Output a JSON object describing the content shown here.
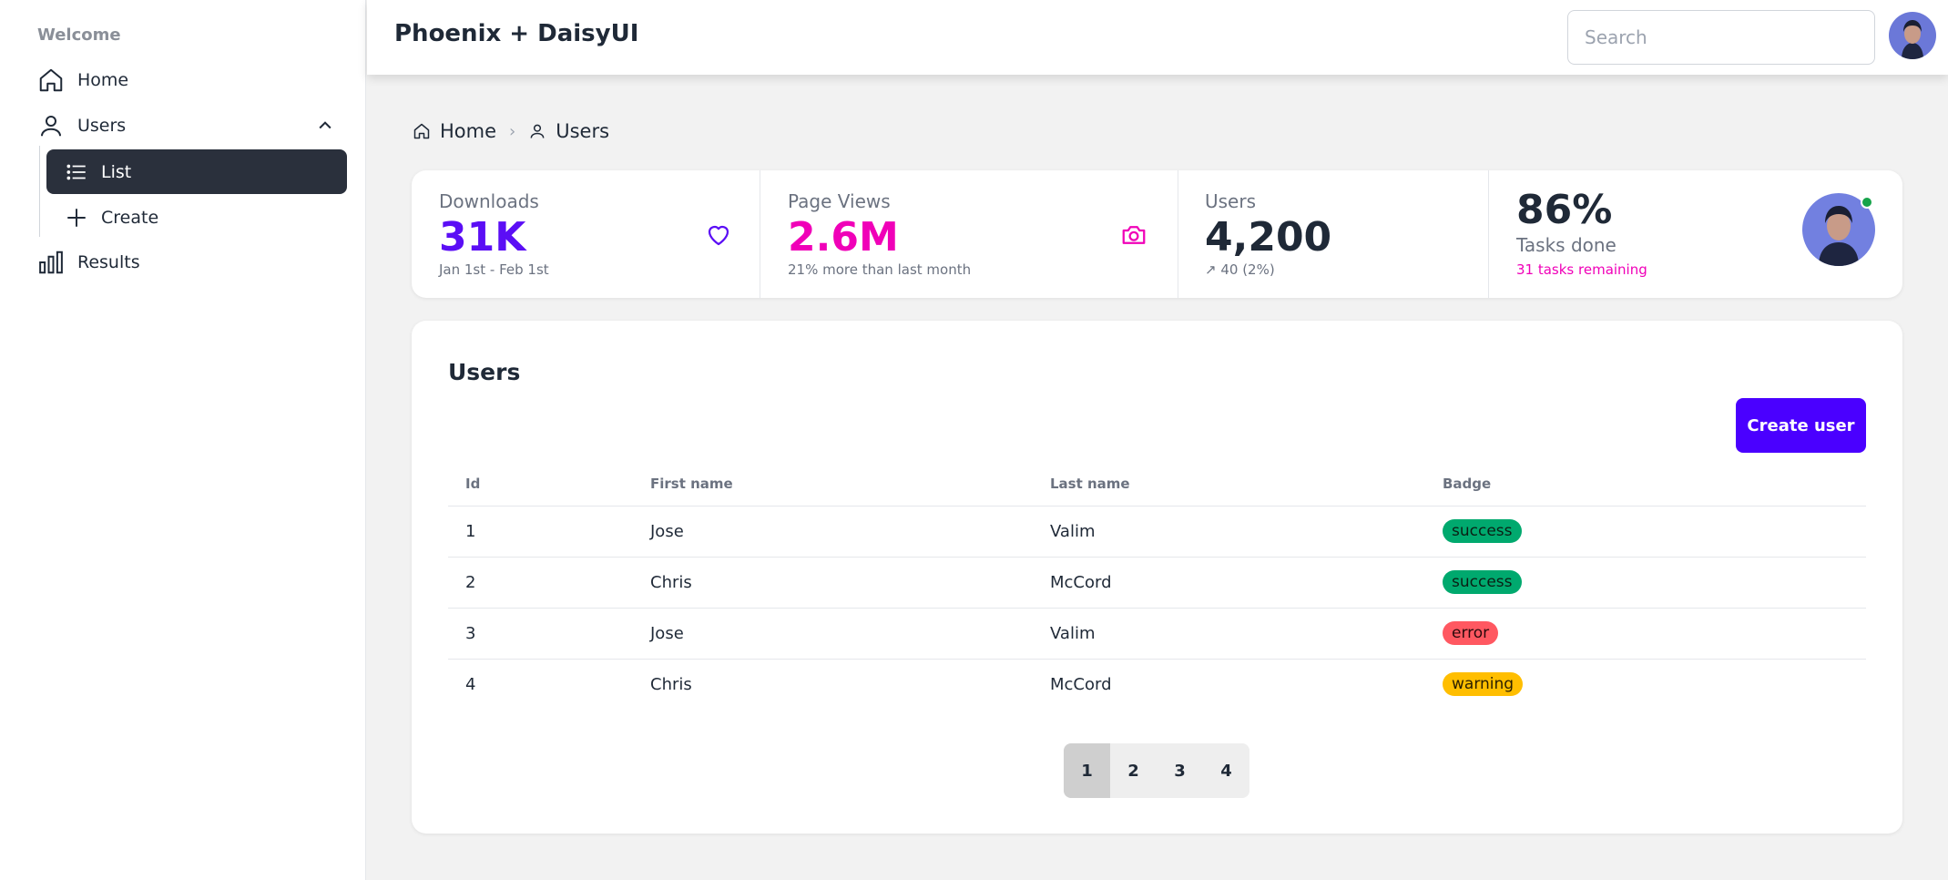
{
  "app_title": "Phoenix + DaisyUI",
  "search": {
    "placeholder": "Search",
    "value": ""
  },
  "sidebar": {
    "section_label": "Welcome",
    "items": [
      {
        "label": "Home",
        "icon": "home-icon"
      },
      {
        "label": "Users",
        "icon": "user-icon",
        "expanded": true,
        "children": [
          {
            "label": "List",
            "icon": "list-icon",
            "active": true
          },
          {
            "label": "Create",
            "icon": "plus-icon"
          }
        ]
      },
      {
        "label": "Results",
        "icon": "bar-chart-icon"
      }
    ]
  },
  "breadcrumb": [
    {
      "label": "Home",
      "icon": "home-icon"
    },
    {
      "label": "Users",
      "icon": "user-icon"
    }
  ],
  "stats": [
    {
      "title": "Downloads",
      "value": "31K",
      "desc": "Jan 1st - Feb 1st",
      "icon": "heart-icon",
      "color": "#5b0ef5"
    },
    {
      "title": "Page Views",
      "value": "2.6M",
      "desc": "21% more than last month",
      "icon": "camera-icon",
      "color": "#f000b8"
    },
    {
      "title": "Users",
      "value": "4,200",
      "desc": "↗︎ 40 (2%)"
    },
    {
      "title": "Tasks done",
      "value": "86%",
      "desc": "31 tasks remaining",
      "status": "online"
    }
  ],
  "users_card": {
    "title": "Users",
    "create_button": "Create user",
    "columns": [
      "Id",
      "First name",
      "Last name",
      "Badge"
    ],
    "rows": [
      {
        "id": "1",
        "first": "Jose",
        "last": "Valim",
        "badge": "success"
      },
      {
        "id": "2",
        "first": "Chris",
        "last": "McCord",
        "badge": "success"
      },
      {
        "id": "3",
        "first": "Jose",
        "last": "Valim",
        "badge": "error"
      },
      {
        "id": "4",
        "first": "Chris",
        "last": "McCord",
        "badge": "warning"
      }
    ],
    "pages": [
      "1",
      "2",
      "3",
      "4"
    ],
    "current_page": "1"
  },
  "colors": {
    "primary": "#4a00ff",
    "secondary": "#f000b8",
    "success": "#00a96e",
    "error": "#ff5861",
    "warning": "#ffbe00",
    "sidebar_active": "#2a303c"
  }
}
